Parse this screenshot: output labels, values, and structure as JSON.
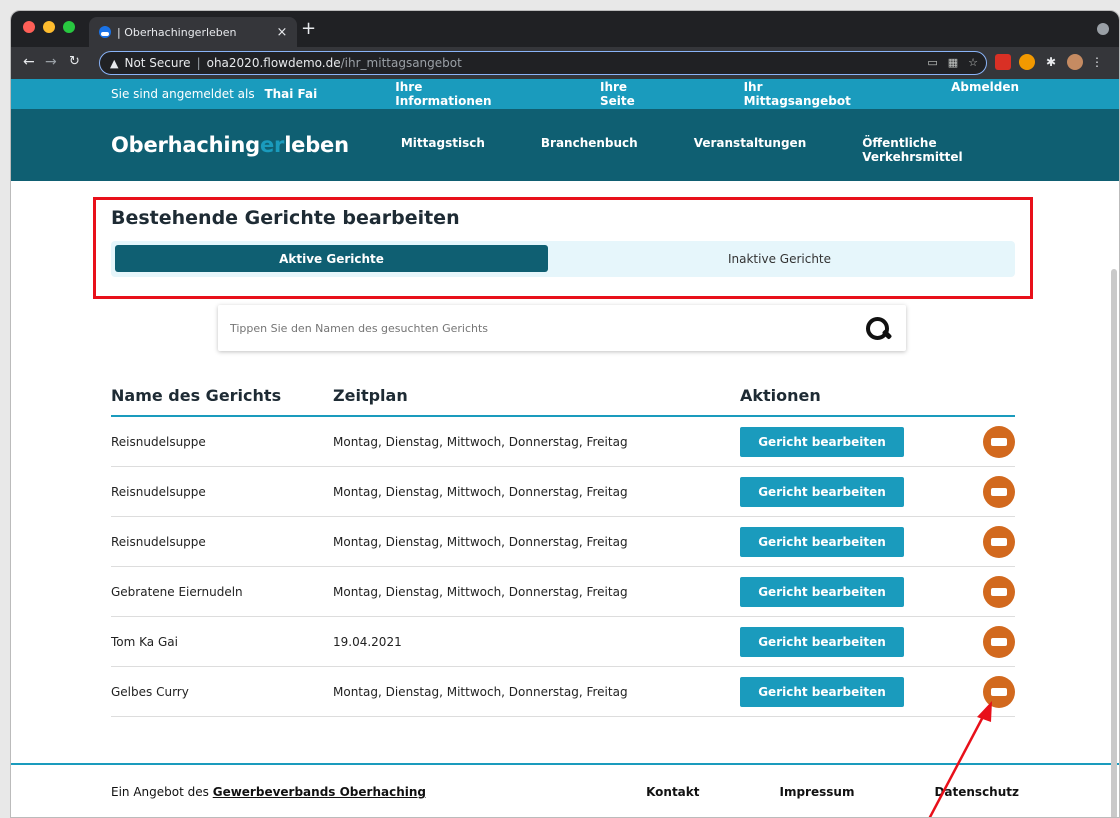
{
  "browser": {
    "tab_title": "| Oberhachingerleben",
    "tab_close": "×",
    "new_tab": "+",
    "security_label": "Not Secure",
    "url_host": "oha2020.flowdemo.de",
    "url_path": "/ihr_mittagsangebot",
    "icons": [
      "back-arrow-icon",
      "forward-arrow-icon",
      "reload-icon",
      "warning-icon",
      "cast-icon",
      "qr-icon",
      "star-icon",
      "calendar-extension-icon",
      "orange-extension-icon",
      "puzzle-icon",
      "avatar-icon",
      "more-icon"
    ]
  },
  "topbar": {
    "logged_prefix": "Sie sind angemeldet als",
    "user_name": "Thai Fai",
    "links": [
      "Ihre Informationen",
      "Ihre Seite",
      "Ihr Mittagsangebot",
      "Abmelden"
    ]
  },
  "nav": {
    "logo_main": "Oberhaching",
    "logo_er": "er",
    "logo_end": "leben",
    "links": [
      "Mittagstisch",
      "Branchenbuch",
      "Veranstaltungen",
      "Öffentliche Verkehrsmittel"
    ]
  },
  "section": {
    "title": "Bestehende Gerichte bearbeiten",
    "tab_active": "Aktive Gerichte",
    "tab_inactive": "Inaktive Gerichte"
  },
  "search": {
    "placeholder": "Tippen Sie den Namen des gesuchten Gerichts"
  },
  "table": {
    "headers": [
      "Name des Gerichts",
      "Zeitplan",
      "Aktionen"
    ],
    "edit_label": "Gericht bearbeiten",
    "rows": [
      {
        "name": "Reisnudelsuppe",
        "schedule": "Montag, Dienstag, Mittwoch, Donnerstag, Freitag"
      },
      {
        "name": "Reisnudelsuppe",
        "schedule": "Montag, Dienstag, Mittwoch, Donnerstag, Freitag"
      },
      {
        "name": "Reisnudelsuppe",
        "schedule": "Montag, Dienstag, Mittwoch, Donnerstag, Freitag"
      },
      {
        "name": "Gebratene Eiernudeln",
        "schedule": "Montag, Dienstag, Mittwoch, Donnerstag, Freitag"
      },
      {
        "name": "Tom Ka Gai",
        "schedule": "19.04.2021"
      },
      {
        "name": "Gelbes Curry",
        "schedule": "Montag, Dienstag, Mittwoch, Donnerstag, Freitag"
      }
    ]
  },
  "footer": {
    "credit_prefix": "Ein Angebot des",
    "credit_link": "Gewerbeverbands Oberhaching",
    "links": [
      "Kontakt",
      "Impressum",
      "Datenschutz"
    ]
  },
  "colors": {
    "topbar": "#1a9bbd",
    "nav": "#0f5f72",
    "accent": "#1a9bbd",
    "delete": "#d2691e",
    "highlight": "#e8101a"
  }
}
